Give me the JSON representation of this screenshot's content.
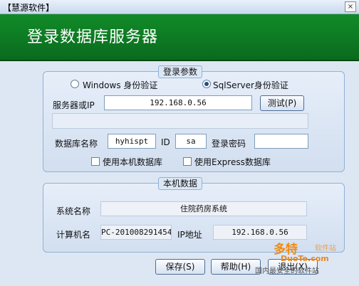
{
  "window": {
    "title": "【慧源软件】",
    "close_glyph": "×"
  },
  "banner": {
    "title": "登录数据库服务器"
  },
  "login_group": {
    "title": "登录参数",
    "auth_windows": "Windows  身份验证",
    "auth_sql": "SqlServer身份验证",
    "auth_selected": "sql",
    "server_label": "服务器或IP",
    "server_value": "192.168.0.56",
    "test_button": "测试(P)",
    "db_name_label": "数据库名称",
    "db_name_value": "hyhispt",
    "id_label": "ID",
    "id_value": "sa",
    "password_label": "登录密码",
    "password_value": "",
    "use_local_db": "使用本机数据库",
    "use_express_db": "使用Express数据库"
  },
  "local_group": {
    "title": "本机数据",
    "system_name_label": "系统名称",
    "system_name_value": "住院药房系统",
    "computer_name_label": "计算机名",
    "computer_name_value": "PC-201008291454",
    "ip_label": "IP地址",
    "ip_value": "192.168.0.56"
  },
  "buttons": {
    "save": "保存(S)",
    "help": "帮助(H)",
    "exit": "退出(X)"
  },
  "watermark": {
    "logo": "多特",
    "sub": "软件站",
    "url": "DuoTe.com",
    "foot": "国内最安全的软件站"
  },
  "colors": {
    "banner": "#0d7a23",
    "window_bg": "#dde7f3",
    "group_border": "#93b0d6"
  }
}
